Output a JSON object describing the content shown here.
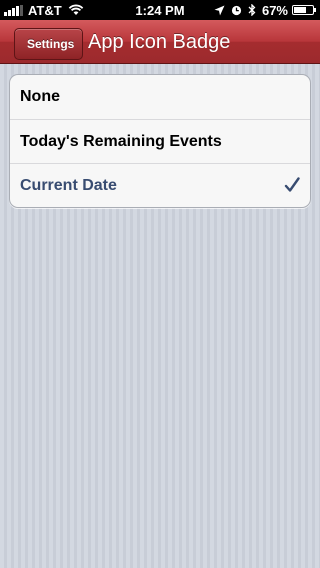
{
  "status_bar": {
    "carrier": "AT&T",
    "time": "1:24 PM",
    "battery_percent": "67%",
    "battery_level": 0.67
  },
  "nav": {
    "back_label": "Settings",
    "title": "App Icon Badge"
  },
  "options": [
    {
      "label": "None",
      "selected": false
    },
    {
      "label": "Today's Remaining Events",
      "selected": false
    },
    {
      "label": "Current Date",
      "selected": true
    }
  ],
  "colors": {
    "nav_bar": "#b8363a",
    "selected_text": "#384c71",
    "checkmark": "#384c71"
  }
}
